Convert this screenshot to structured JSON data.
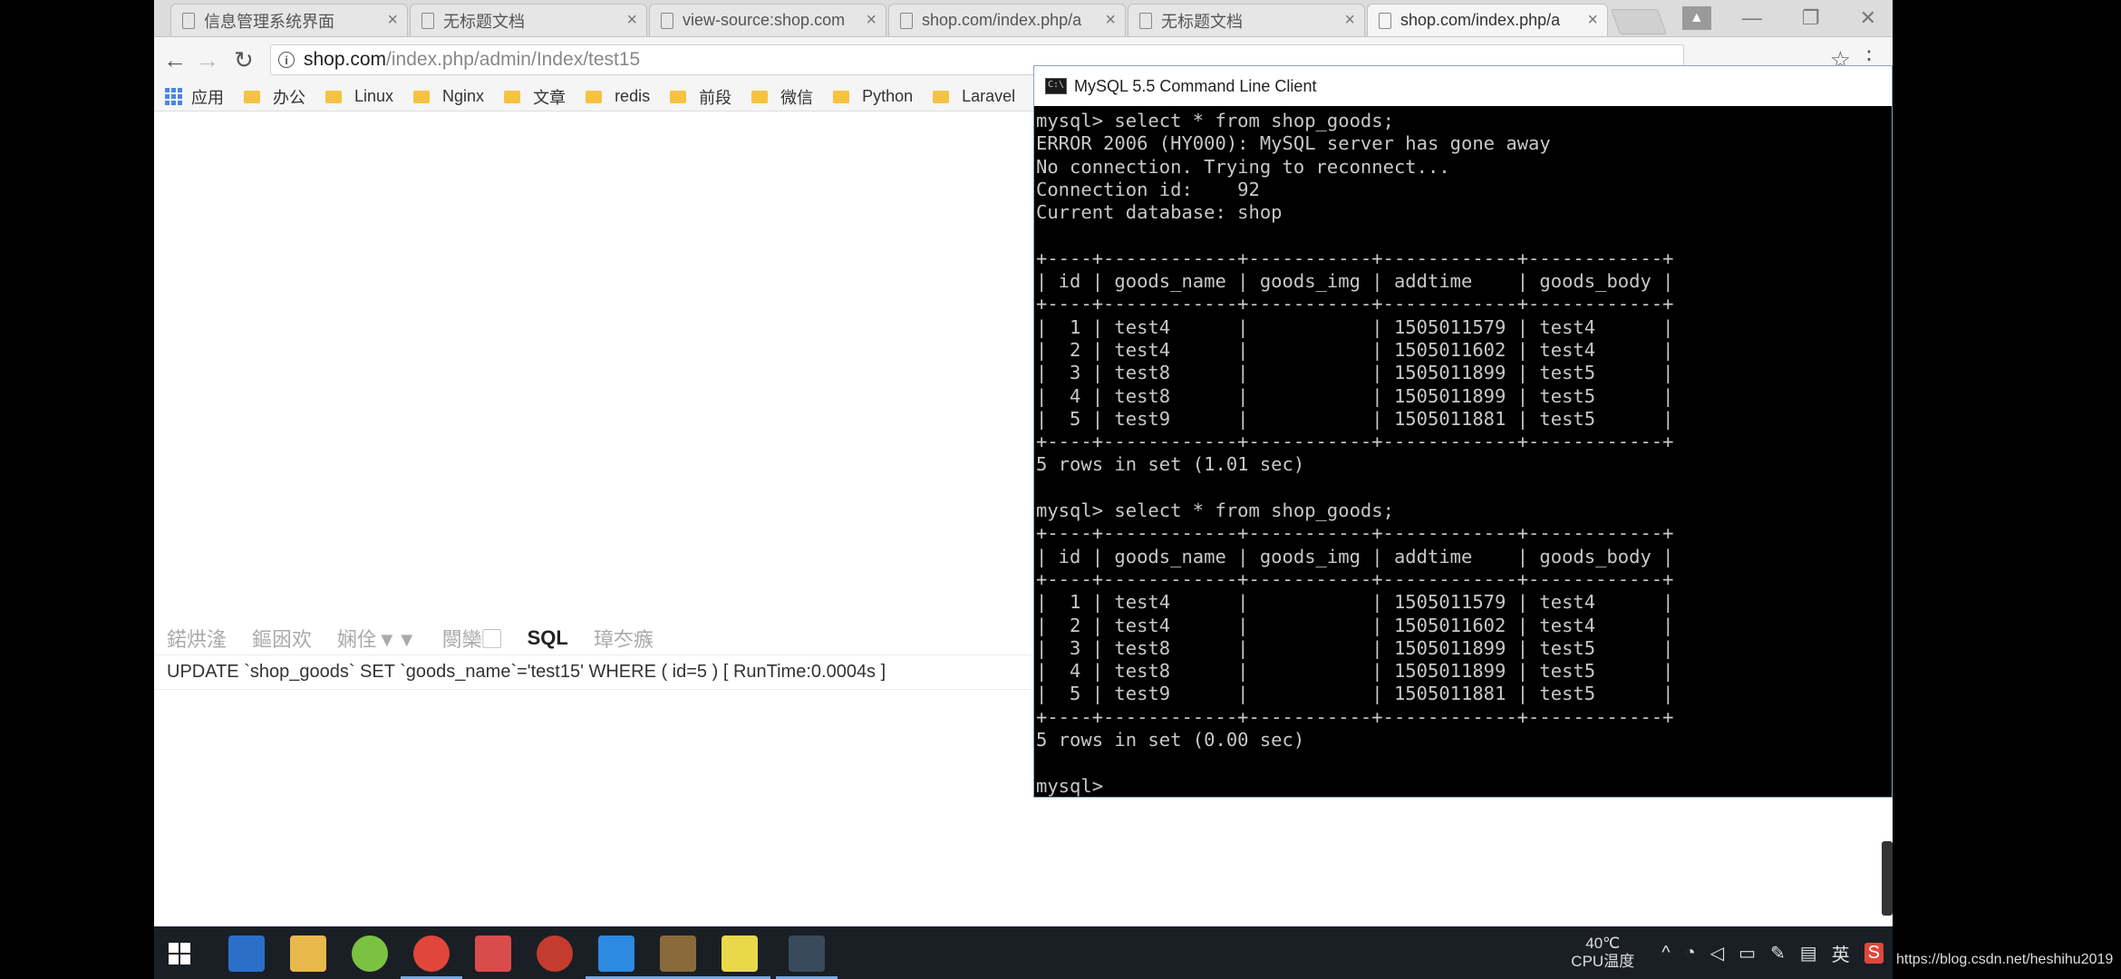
{
  "browser": {
    "tabs": [
      {
        "label": "信息管理系统界面"
      },
      {
        "label": "无标题文档"
      },
      {
        "label": "view-source:shop.com"
      },
      {
        "label": "shop.com/index.php/a"
      },
      {
        "label": "无标题文档"
      },
      {
        "label": "shop.com/index.php/a"
      }
    ],
    "url_host": "shop.com",
    "url_path": "/index.php/admin/Index/test15",
    "bookmarks": [
      {
        "label": "应用"
      },
      {
        "label": "办公"
      },
      {
        "label": "Linux"
      },
      {
        "label": "Nginx"
      },
      {
        "label": "文章"
      },
      {
        "label": "redis"
      },
      {
        "label": "前段"
      },
      {
        "label": "微信"
      },
      {
        "label": "Python"
      },
      {
        "label": "Laravel"
      }
    ]
  },
  "page": {
    "trace_tabs": [
      "鍩烘湰",
      "鏂囦欢",
      "娴佺▼",
      "閿欒",
      "SQL",
      "璋冭瘯"
    ],
    "trace_arrow": "▼",
    "trace_box": "▢",
    "sql_line": "UPDATE `shop_goods` SET `goods_name`='test15' WHERE ( id=5 ) [ RunTime:0.0004s ]"
  },
  "console": {
    "title": "MySQL 5.5 Command Line Client",
    "icon_text": "C:\\",
    "lines": [
      "mysql> select * from shop_goods;",
      "ERROR 2006 (HY000): MySQL server has gone away",
      "No connection. Trying to reconnect...",
      "Connection id:    92",
      "Current database: shop",
      "",
      "+----+------------+-----------+------------+------------+",
      "| id | goods_name | goods_img | addtime    | goods_body |",
      "+----+------------+-----------+------------+------------+",
      "|  1 | test4      |           | 1505011579 | test4      |",
      "|  2 | test4      |           | 1505011602 | test4      |",
      "|  3 | test8      |           | 1505011899 | test5      |",
      "|  4 | test8      |           | 1505011899 | test5      |",
      "|  5 | test9      |           | 1505011881 | test5      |",
      "+----+------------+-----------+------------+------------+",
      "5 rows in set (1.01 sec)",
      "",
      "mysql> select * from shop_goods;",
      "+----+------------+-----------+------------+------------+",
      "| id | goods_name | goods_img | addtime    | goods_body |",
      "+----+------------+-----------+------------+------------+",
      "|  1 | test4      |           | 1505011579 | test4      |",
      "|  2 | test4      |           | 1505011602 | test4      |",
      "|  3 | test8      |           | 1505011899 | test5      |",
      "|  4 | test8      |           | 1505011899 | test5      |",
      "|  5 | test9      |           | 1505011881 | test5      |",
      "+----+------------+-----------+------------+------------+",
      "5 rows in set (0.00 sec)",
      "",
      "mysql> "
    ]
  },
  "taskbar": {
    "cpu_temp": "40℃",
    "cpu_label": "CPU温度",
    "ime": "英",
    "watermark": "https://blog.csdn.net/heshihu2019"
  }
}
